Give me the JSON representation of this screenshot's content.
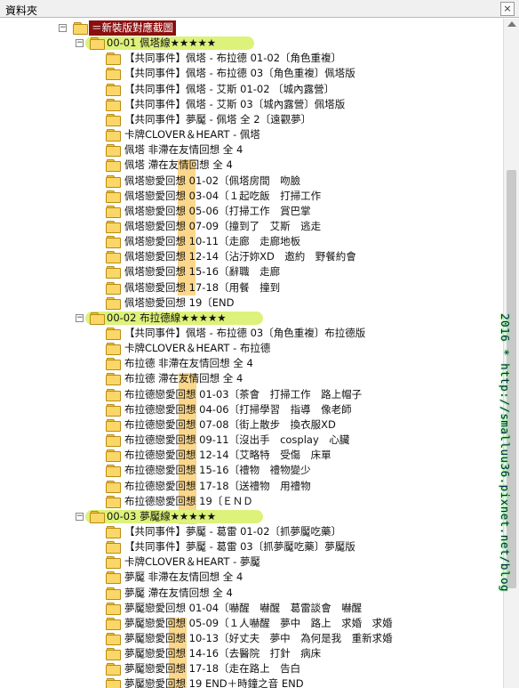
{
  "pane": {
    "title": "資料夾",
    "close_glyph": "×"
  },
  "root": {
    "label": "＝新裝版對應截圖",
    "expander": "−"
  },
  "groups": [
    {
      "label": "00-01 佩塔線★★★★★",
      "expander": "−",
      "items": [
        "【共同事件】佩塔 - 布拉德 01-02〔角色重複〕",
        "【共同事件】佩塔 - 布拉德 03〔角色重複〕佩塔版",
        "【共同事件】佩塔 - 艾斯 01-02 〔城內露營〕",
        "【共同事件】佩塔 - 艾斯 03〔城內露營〕佩塔版",
        "【共同事件】夢魘 - 佩塔 全 2〔遠觀夢〕",
        "卡牌CLOVER＆HEART - 佩塔",
        "佩塔 非滯在友情回想 全 4",
        "佩塔 滯在友情回想 全 4",
        "佩塔戀愛回想 01-02〔佩塔房間　吻臉",
        "佩塔戀愛回想 03-04〔１起吃飯　打掃工作",
        "佩塔戀愛回想 05-06〔打掃工作　賞巴掌",
        "佩塔戀愛回想 07-09〔撞到了　艾斯　逃走",
        "佩塔戀愛回想 10-11〔走廊　走廊地板",
        "佩塔戀愛回想 12-14〔沾汙妳XD　邀約　野餐約會",
        "佩塔戀愛回想 15-16〔辭職　走廊",
        "佩塔戀愛回想 17-18〔用餐　撞到",
        "佩塔戀愛回想 19〔END"
      ]
    },
    {
      "label": "00-02 布拉德線★★★★★",
      "expander": "−",
      "items": [
        "【共同事件】佩塔 - 布拉德 03〔角色重複〕布拉德版",
        "卡牌CLOVER＆HEART - 布拉德",
        "布拉德 非滯在友情回想 全 4",
        "布拉德 滯在友情回想 全 4",
        "布拉德戀愛回想 01-03〔茶會　打掃工作　路上帽子",
        "布拉德戀愛回想 04-06〔打掃學習　指導　像老師",
        "布拉德戀愛回想 07-08〔街上散步　換衣服XD",
        "布拉德戀愛回想 09-11〔沒出手　cosplay　心臟",
        "布拉德戀愛回想 12-14〔艾略特　受傷　床單",
        "布拉德戀愛回想 15-16〔禮物　禮物變少",
        "布拉德戀愛回想 17-18〔送禮物　用禮物",
        "布拉德戀愛回想 19〔ＥＮＤ"
      ]
    },
    {
      "label": "00-03 夢魘線★★★★★",
      "expander": "−",
      "items": [
        "【共同事件】夢魘 - 葛雷 01-02〔抓夢魘吃藥〕",
        "【共同事件】夢魘 - 葛雷 03〔抓夢魘吃藥〕夢魘版",
        "卡牌CLOVER＆HEART - 夢魘",
        "夢魘 非滯在友情回想 全 4",
        "夢魘 滯在友情回想 全 4",
        "夢魘戀愛回想 01-04〔嚇醒　嚇醒　葛雷談會　嚇醒",
        "夢魘戀愛回想 05-09〔１人嚇醒　夢中　路上　求婚　求婚",
        "夢魘戀愛回想 10-13〔好丈夫　夢中　為何是我　重新求婚",
        "夢魘戀愛回想 14-16〔去醫院　打針　病床",
        "夢魘戀愛回想 17-18〔走在路上　告白",
        "夢魘戀愛回想 19 END＋時鐘之音 END"
      ]
    }
  ],
  "watermark": "2016 * http://smalluu36.pixnet.net/blog",
  "colors": {
    "root_bg": "#8b0f0f",
    "group_highlight": "#ddf27a",
    "column_band": "#fbd78b",
    "watermark_glow": "#7cf57c"
  }
}
